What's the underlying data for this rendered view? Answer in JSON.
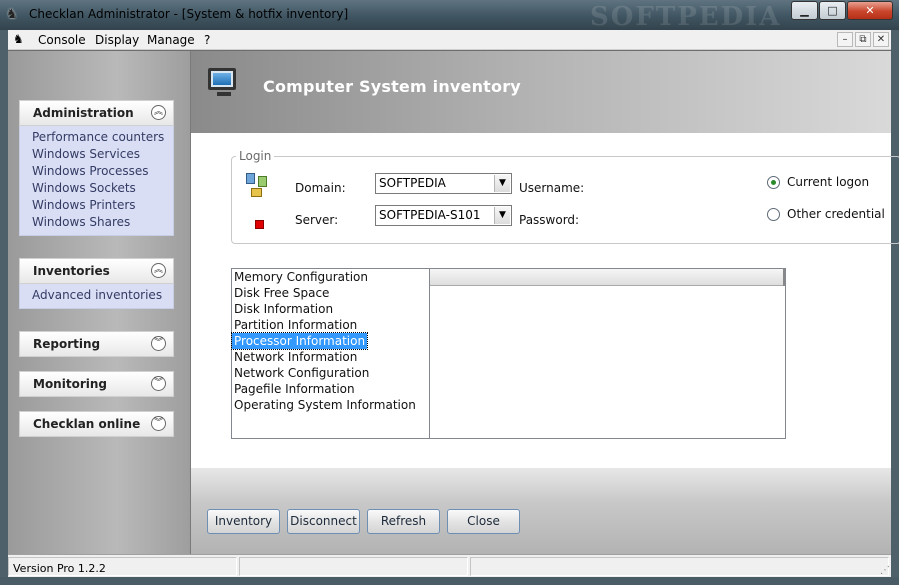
{
  "window": {
    "title": "Checklan Administrator - [System & hotfix inventory]",
    "watermark": "SOFTPEDIA",
    "minimize": "▁",
    "maximize": "□",
    "close": "✕"
  },
  "menubar": {
    "items": [
      "Console",
      "Display",
      "Manage",
      "?"
    ],
    "mdi_minimize": "–",
    "mdi_restore": "⧉",
    "mdi_close": "✕"
  },
  "sidebar": {
    "sections": [
      {
        "label": "Administration",
        "expanded": true,
        "items": [
          "Performance counters",
          "Windows Services",
          "Windows Processes",
          "Windows Sockets",
          "Windows Printers",
          "Windows Shares"
        ]
      },
      {
        "label": "Inventories",
        "expanded": true,
        "items": [
          "Advanced inventories"
        ]
      },
      {
        "label": "Reporting",
        "expanded": false,
        "items": []
      },
      {
        "label": "Monitoring",
        "expanded": false,
        "items": []
      },
      {
        "label": "Checklan online",
        "expanded": false,
        "items": []
      }
    ],
    "collapse_glyph": "︽",
    "expand_glyph": "︾"
  },
  "header": {
    "title": "Computer System  inventory"
  },
  "login": {
    "legend": "Login",
    "domain_label": "Domain:",
    "domain_value": "SOFTPEDIA",
    "server_label": "Server:",
    "server_value": "SOFTPEDIA-S101",
    "username_label": "Username:",
    "password_label": "Password:",
    "current_logon_label": "Current logon",
    "other_credential_label": "Other credential",
    "selected_credential": "current_logon",
    "connection_status_color": "#e00000"
  },
  "inventory_list": {
    "items": [
      "Memory Configuration",
      "Disk Free Space",
      "Disk Information",
      "Partition Information",
      "Processor Information",
      "Network Information",
      "Network Configuration",
      "Pagefile Information",
      "Operating System Information"
    ],
    "selected": "Processor Information"
  },
  "buttons": {
    "inventory": "Inventory",
    "disconnect": "Disconnect",
    "refresh": "Refresh",
    "close": "Close"
  },
  "statusbar": {
    "version": "Version Pro 1.2.2",
    "grip": "⋰"
  },
  "colors": {
    "accent_selection": "#3399ff",
    "panel_items_bg": "#d9def5"
  },
  "dropdown_arrow": "▼"
}
